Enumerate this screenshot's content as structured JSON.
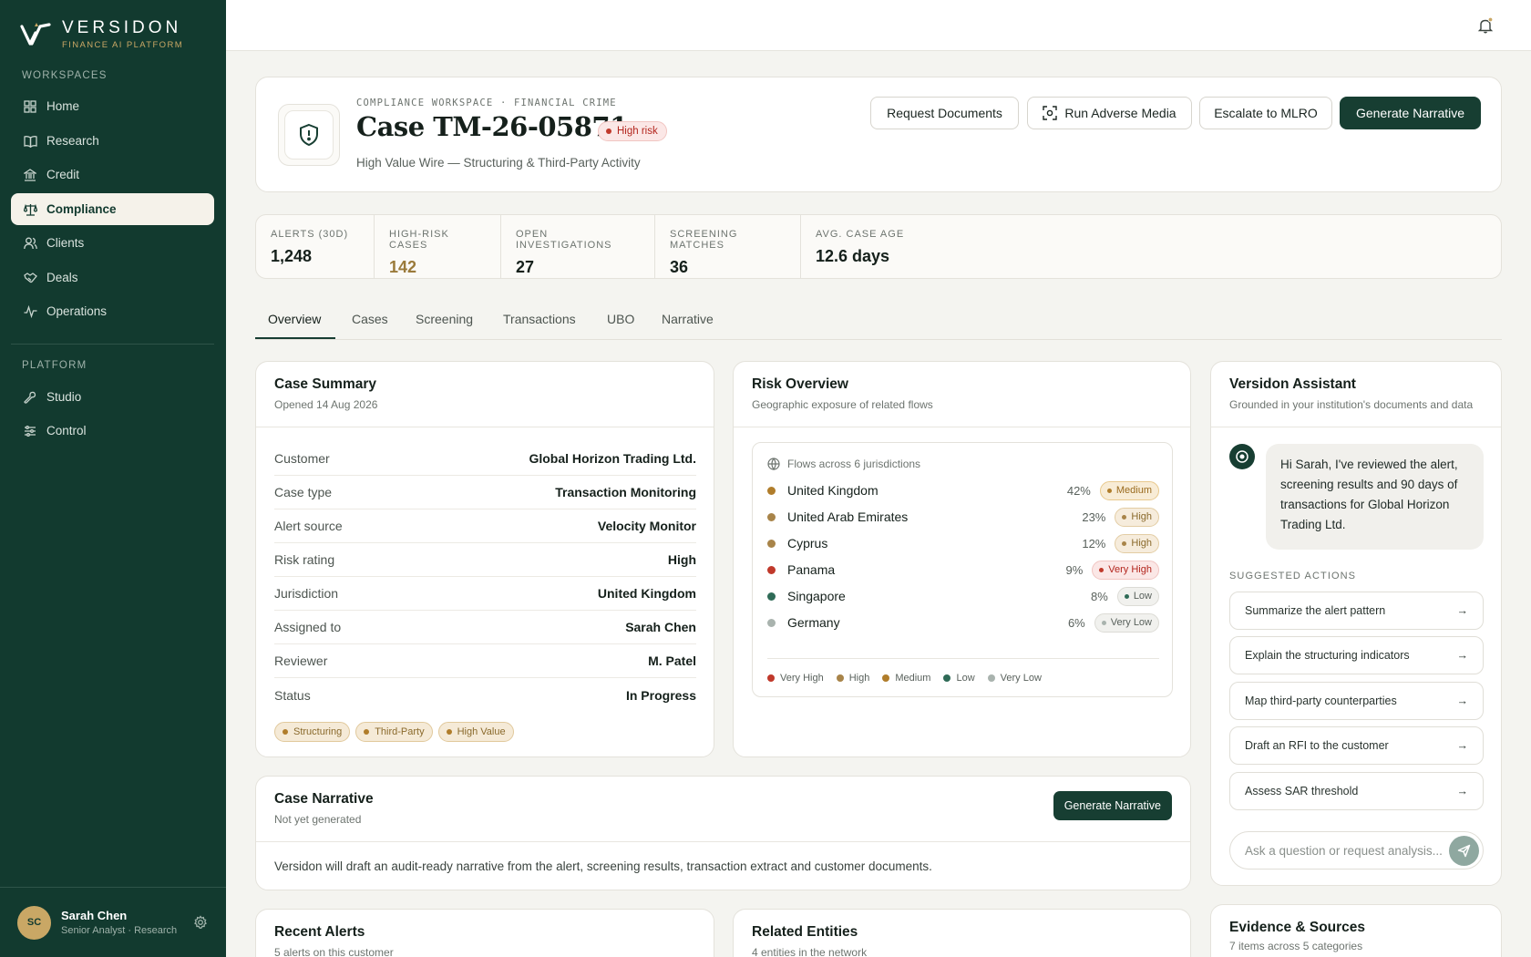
{
  "brand": {
    "name": "VERSIDON",
    "tagline": "FINANCE AI PLATFORM"
  },
  "sidebar": {
    "workspaces_label": "WORKSPACES",
    "platform_label": "PLATFORM",
    "items": [
      {
        "label": "Home",
        "icon": "grid-icon"
      },
      {
        "label": "Research",
        "icon": "book-icon"
      },
      {
        "label": "Credit",
        "icon": "bank-icon"
      },
      {
        "label": "Compliance",
        "icon": "scale-icon",
        "active": true
      },
      {
        "label": "Clients",
        "icon": "users-icon"
      },
      {
        "label": "Deals",
        "icon": "handshake-icon"
      },
      {
        "label": "Operations",
        "icon": "activity-icon"
      }
    ],
    "platform_items": [
      {
        "label": "Studio",
        "icon": "wrench-icon"
      },
      {
        "label": "Control",
        "icon": "sliders-icon"
      }
    ],
    "user": {
      "initials": "SC",
      "name": "Sarah Chen",
      "role": "Senior Analyst · Research"
    }
  },
  "header": {
    "eyebrow": "COMPLIANCE WORKSPACE · FINANCIAL CRIME",
    "title": "Case TM-26-05871",
    "risk_badge": "High risk",
    "subtitle": "High Value Wire — Structuring & Third-Party Activity",
    "buttons": {
      "request_documents": "Request Documents",
      "run_adverse_media": "Run Adverse Media",
      "escalate": "Escalate to MLRO",
      "generate_narrative": "Generate Narrative"
    }
  },
  "kpis": [
    {
      "label": "ALERTS (30D)",
      "value": "1,248"
    },
    {
      "label": "HIGH-RISK CASES",
      "value": "142"
    },
    {
      "label": "OPEN INVESTIGATIONS",
      "value": "27"
    },
    {
      "label": "SCREENING MATCHES",
      "value": "36"
    },
    {
      "label": "AVG. CASE AGE",
      "value": "12.6 days"
    }
  ],
  "tabs": [
    "Overview",
    "Cases",
    "Screening",
    "Transactions",
    "UBO",
    "Narrative"
  ],
  "case_summary": {
    "title": "Case Summary",
    "subtitle": "Opened 14 Aug 2026",
    "rows": [
      {
        "key": "Customer",
        "value": "Global Horizon Trading Ltd."
      },
      {
        "key": "Case type",
        "value": "Transaction Monitoring"
      },
      {
        "key": "Alert source",
        "value": "Velocity Monitor"
      },
      {
        "key": "Risk rating",
        "value": "High"
      },
      {
        "key": "Jurisdiction",
        "value": "United Kingdom"
      },
      {
        "key": "Assigned to",
        "value": "Sarah Chen"
      },
      {
        "key": "Reviewer",
        "value": "M. Patel"
      },
      {
        "key": "Status",
        "value": "In Progress"
      }
    ],
    "tags": [
      "Structuring",
      "Third-Party",
      "High Value"
    ]
  },
  "risk_overview": {
    "title": "Risk Overview",
    "subtitle": "Geographic exposure of related flows",
    "flows_label": "Flows across 6 jurisdictions",
    "jurisdictions": [
      {
        "name": "United Kingdom",
        "pct": "42%",
        "level": "Medium"
      },
      {
        "name": "United Arab Emirates",
        "pct": "23%",
        "level": "High"
      },
      {
        "name": "Cyprus",
        "pct": "12%",
        "level": "High"
      },
      {
        "name": "Panama",
        "pct": "9%",
        "level": "Very High"
      },
      {
        "name": "Singapore",
        "pct": "8%",
        "level": "Low"
      },
      {
        "name": "Germany",
        "pct": "6%",
        "level": "Very Low"
      }
    ],
    "legend": [
      "Very High",
      "High",
      "Medium",
      "Low",
      "Very Low"
    ],
    "level_colors": {
      "Very High": "#c0392b",
      "High": "#a88449",
      "Medium": "#b07d2b",
      "Low": "#2f6b57",
      "Very Low": "#a9b3ae"
    }
  },
  "assistant": {
    "title": "Versidon Assistant",
    "subtitle": "Grounded in your institution's documents and data",
    "message": "Hi Sarah, I've reviewed the alert, screening results and 90 days of transactions for Global Horizon Trading Ltd.",
    "suggested_label": "SUGGESTED ACTIONS",
    "suggestions": [
      "Summarize the alert pattern",
      "Explain the structuring indicators",
      "Map third-party counterparties",
      "Draft an RFI to the customer",
      "Assess SAR threshold"
    ],
    "input_placeholder": "Ask a question or request analysis..."
  },
  "narrative": {
    "title": "Case Narrative",
    "subtitle": "Not yet generated",
    "button": "Generate Narrative",
    "body": "Versidon will draft an audit-ready narrative from the alert, screening results, transaction extract and customer documents."
  },
  "recent_alerts": {
    "title": "Recent Alerts",
    "subtitle": "5 alerts on this customer"
  },
  "related_entities": {
    "title": "Related Entities",
    "subtitle": "4 entities in the network"
  },
  "evidence": {
    "title": "Evidence & Sources",
    "subtitle": "7 items across 5 categories"
  },
  "colors": {
    "sidebar": "#123a2f",
    "accent_gold": "#c9a765",
    "primary": "#173e32",
    "danger": "#c0392b"
  }
}
